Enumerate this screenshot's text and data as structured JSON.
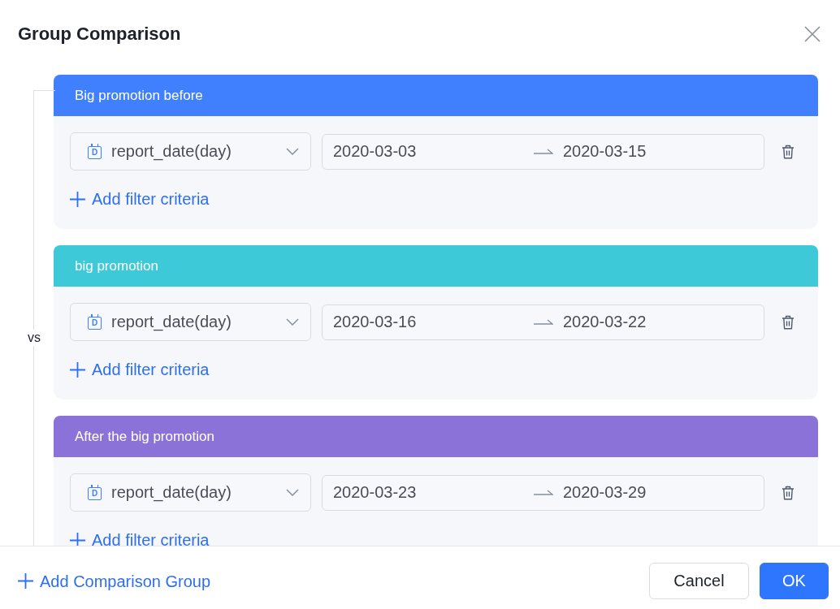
{
  "dialog": {
    "title": "Group Comparison"
  },
  "connector": {
    "label": "vs"
  },
  "groups": [
    {
      "name": "Big promotion before",
      "color": "#4080ff",
      "filters": [
        {
          "field": "report_date(day)",
          "type_letter": "D",
          "start": "2020-03-03",
          "end": "2020-03-15"
        }
      ],
      "add_filter": "Add filter criteria"
    },
    {
      "name": "big promotion",
      "color": "#3ec9d9",
      "filters": [
        {
          "field": "report_date(day)",
          "type_letter": "D",
          "start": "2020-03-16",
          "end": "2020-03-22"
        }
      ],
      "add_filter": "Add filter criteria"
    },
    {
      "name": "After the big promotion",
      "color": "#8b72d8",
      "filters": [
        {
          "field": "report_date(day)",
          "type_letter": "D",
          "start": "2020-03-23",
          "end": "2020-03-29"
        }
      ],
      "add_filter": "Add filter criteria"
    }
  ],
  "footer": {
    "add_group": "Add Comparison Group",
    "buttons": [
      {
        "label": "Cancel",
        "kind": "secondary"
      },
      {
        "label": "OK",
        "kind": "primary"
      }
    ]
  }
}
